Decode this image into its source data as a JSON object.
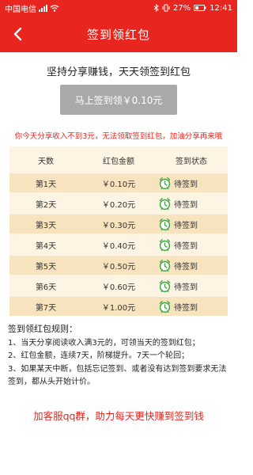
{
  "status_bar": {
    "carrier": "中国电信",
    "battery": "27%",
    "time": "12:41"
  },
  "header": {
    "title": "签到领红包"
  },
  "slogan": "坚持分享赚钱，天天领签到红包",
  "sign_button": "马上签到领￥0.10元",
  "notice": "你今天分享收入不到3元，无法领取签到红包，加油分享再来哦",
  "table": {
    "headers": [
      "天数",
      "红包金额",
      "签到状态"
    ],
    "rows": [
      {
        "day": "第1天",
        "amount": "￥0.10元",
        "status": "待签到"
      },
      {
        "day": "第2天",
        "amount": "￥0.20元",
        "status": "待签到"
      },
      {
        "day": "第3天",
        "amount": "￥0.30元",
        "status": "待签到"
      },
      {
        "day": "第4天",
        "amount": "￥0.40元",
        "status": "待签到"
      },
      {
        "day": "第5天",
        "amount": "￥0.50元",
        "status": "待签到"
      },
      {
        "day": "第6天",
        "amount": "￥0.60元",
        "status": "待签到"
      },
      {
        "day": "第7天",
        "amount": "￥1.00元",
        "status": "待签到"
      }
    ]
  },
  "rules": {
    "title": "签到领红包规则：",
    "items": [
      "1、当天分享阅读收入满3元的，可领当天的签到红包；",
      "2、红包金额，连续7天，阶梯提升。7天一个轮回；",
      "3、如果某天中断，包括忘记签到、或者没有达到签到要求无法签到，都从头开始计价。"
    ]
  },
  "footer_link": "加客服qq群，助力每天更快赚到签到钱",
  "colors": {
    "brand_red": "#e8261f",
    "button_gray": "#a9a9a9",
    "table_bg": "#fdf4e3",
    "table_row_alt": "#f7e3bd",
    "clock_green": "#3aa13a"
  }
}
